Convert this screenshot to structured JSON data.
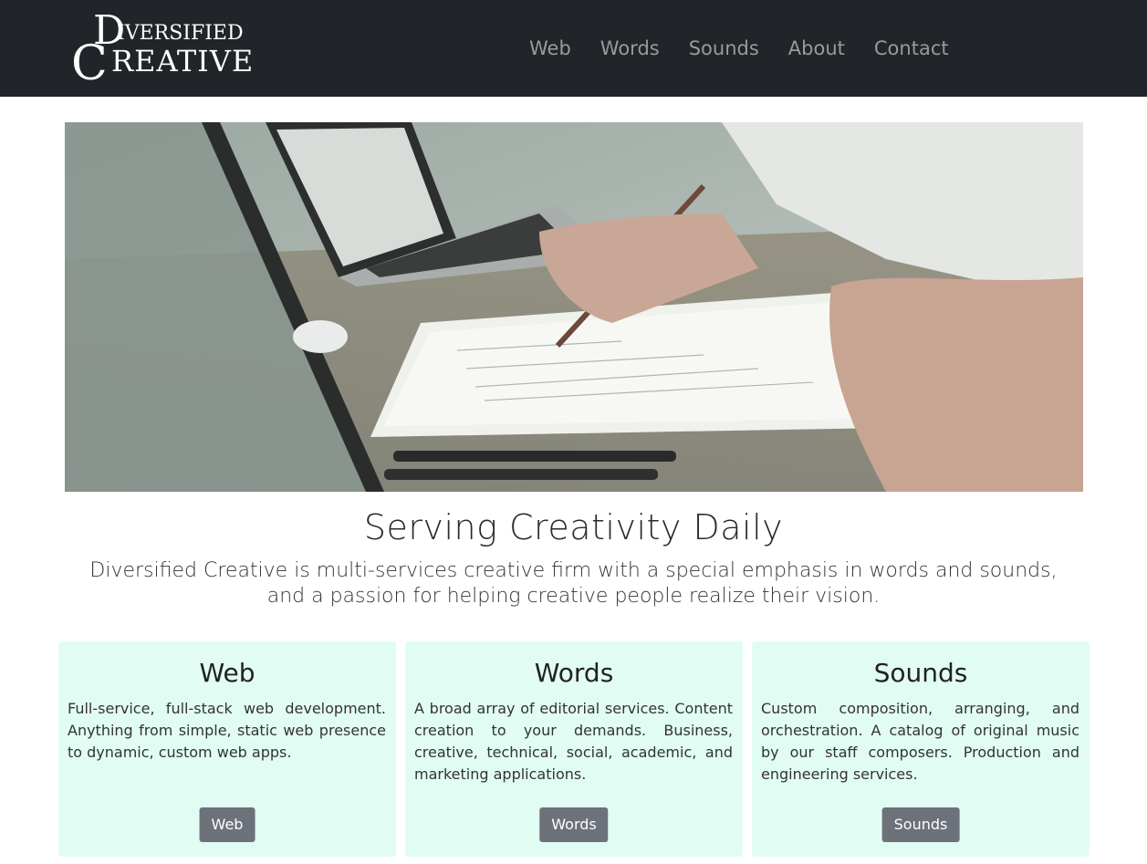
{
  "header": {
    "logo_line1_initial": "D",
    "logo_line1_rest": "IVERSIFIED",
    "logo_line2_initial": "C",
    "logo_line2_rest": "REATIVE",
    "nav": [
      {
        "label": "Web"
      },
      {
        "label": "Words"
      },
      {
        "label": "Sounds"
      },
      {
        "label": "About"
      },
      {
        "label": "Contact"
      }
    ]
  },
  "hero": {
    "image_icon": "photo-icon"
  },
  "intro": {
    "headline": "Serving Creativity Daily",
    "lead": "Diversified Creative is multi-services creative firm with a special emphasis in words and sounds, and a passion for helping creative people realize their vision."
  },
  "cards": [
    {
      "title": "Web",
      "text": "Full-service, full-stack web development. Anything from simple, static web presence to dynamic, custom web apps.",
      "button": "Web"
    },
    {
      "title": "Words",
      "text": "A broad array of editorial services. Content creation to your demands. Business, creative, technical, social, academic, and marketing applications.",
      "button": "Words"
    },
    {
      "title": "Sounds",
      "text": "Custom composition, arranging, and orchestration. A catalog of original music by our staff composers. Production and engineering services.",
      "button": "Sounds"
    }
  ],
  "colors": {
    "navbar_bg": "#212429",
    "nav_link": "#9a9a9a",
    "card_bg": "#e1fdf3",
    "button_bg": "#6c717a"
  }
}
